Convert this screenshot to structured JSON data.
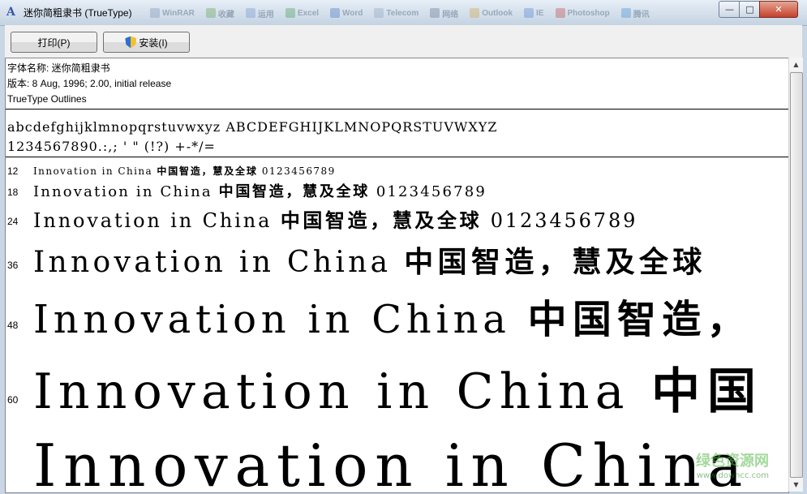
{
  "window": {
    "title": "迷你简粗隶书 (TrueType)",
    "icon": "font-viewer-icon",
    "controls": {
      "minimize": "—",
      "maximize": "□",
      "close": "✕"
    }
  },
  "background_taskbar": [
    "WinRAR",
    "收藏",
    "运用",
    "Excel",
    "Word",
    "Telecom",
    "网络",
    "Outlook",
    "IE",
    "Photoshop",
    "腾讯"
  ],
  "toolbar": {
    "print_label": "打印(P)",
    "install_label": "安装(I)"
  },
  "info": {
    "font_name": "字体名称: 迷你简粗隶书",
    "version": "版本: 8 Aug, 1996; 2.00, initial release",
    "outlines": "TrueType Outlines"
  },
  "charset": {
    "line1": "abcdefghijklmnopqrstuvwxyz ABCDEFGHIJKLMNOPQRSTUVWXYZ",
    "line2": "1234567890.:,; ' \" (!?) +-*/="
  },
  "samples": [
    {
      "size": "12",
      "latin": "Innovation in China",
      "cn": "中国智造，慧及全球",
      "digits": "0123456789"
    },
    {
      "size": "18",
      "latin": "Innovation in China",
      "cn": "中国智造，慧及全球",
      "digits": "0123456789"
    },
    {
      "size": "24",
      "latin": "Innovation in China",
      "cn": "中国智造，慧及全球",
      "digits": "0123456789"
    },
    {
      "size": "36",
      "latin": "Innovation in China",
      "cn": "中国智造，慧及全球",
      "digits": ""
    },
    {
      "size": "48",
      "latin": "Innovation in China",
      "cn": "中国智造，",
      "digits": ""
    },
    {
      "size": "60",
      "latin": "Innovation in China",
      "cn": "中国",
      "digits": ""
    },
    {
      "size": "",
      "latin": "Innovation in China",
      "cn": "",
      "digits": ""
    }
  ],
  "watermark": {
    "main": "绿色资源网",
    "sub": "www.downcc.com"
  }
}
